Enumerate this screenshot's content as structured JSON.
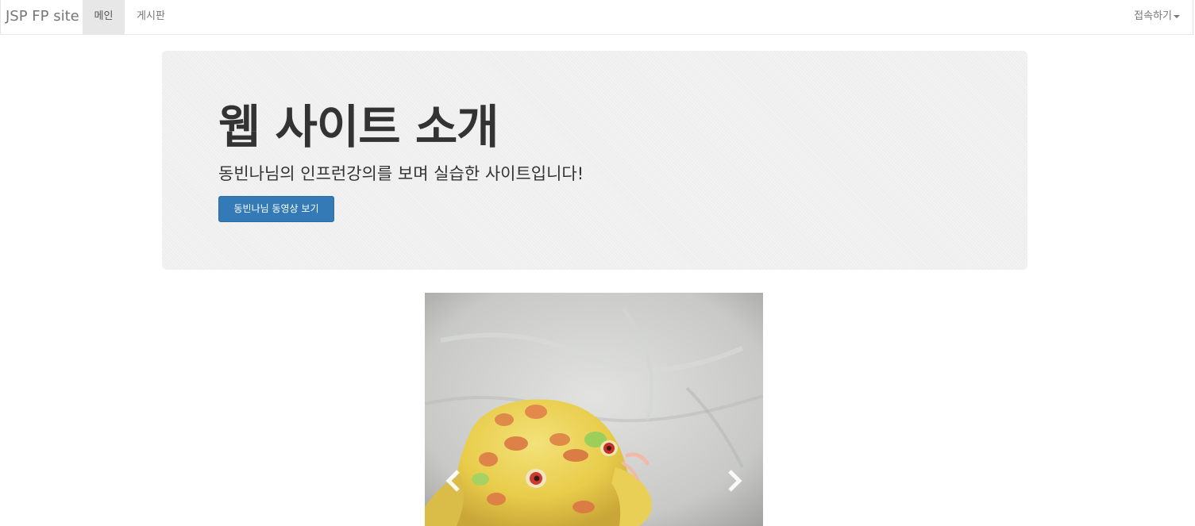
{
  "navbar": {
    "brand": "JSP FP site",
    "items": [
      {
        "label": "메인",
        "active": true
      },
      {
        "label": "게시판",
        "active": false
      }
    ],
    "dropdown_label": "접속하기"
  },
  "jumbotron": {
    "title": "웹 사이트 소개",
    "subtitle": "동빈나님의 인프런강의를 보며 실습한 사이트입니다!",
    "button_label": "동빈나님 동영상 보기",
    "button_color": "#337ab7"
  },
  "carousel": {
    "image_subject": "yellow frog",
    "prev_icon": "chevron-left-icon",
    "next_icon": "chevron-right-icon"
  }
}
